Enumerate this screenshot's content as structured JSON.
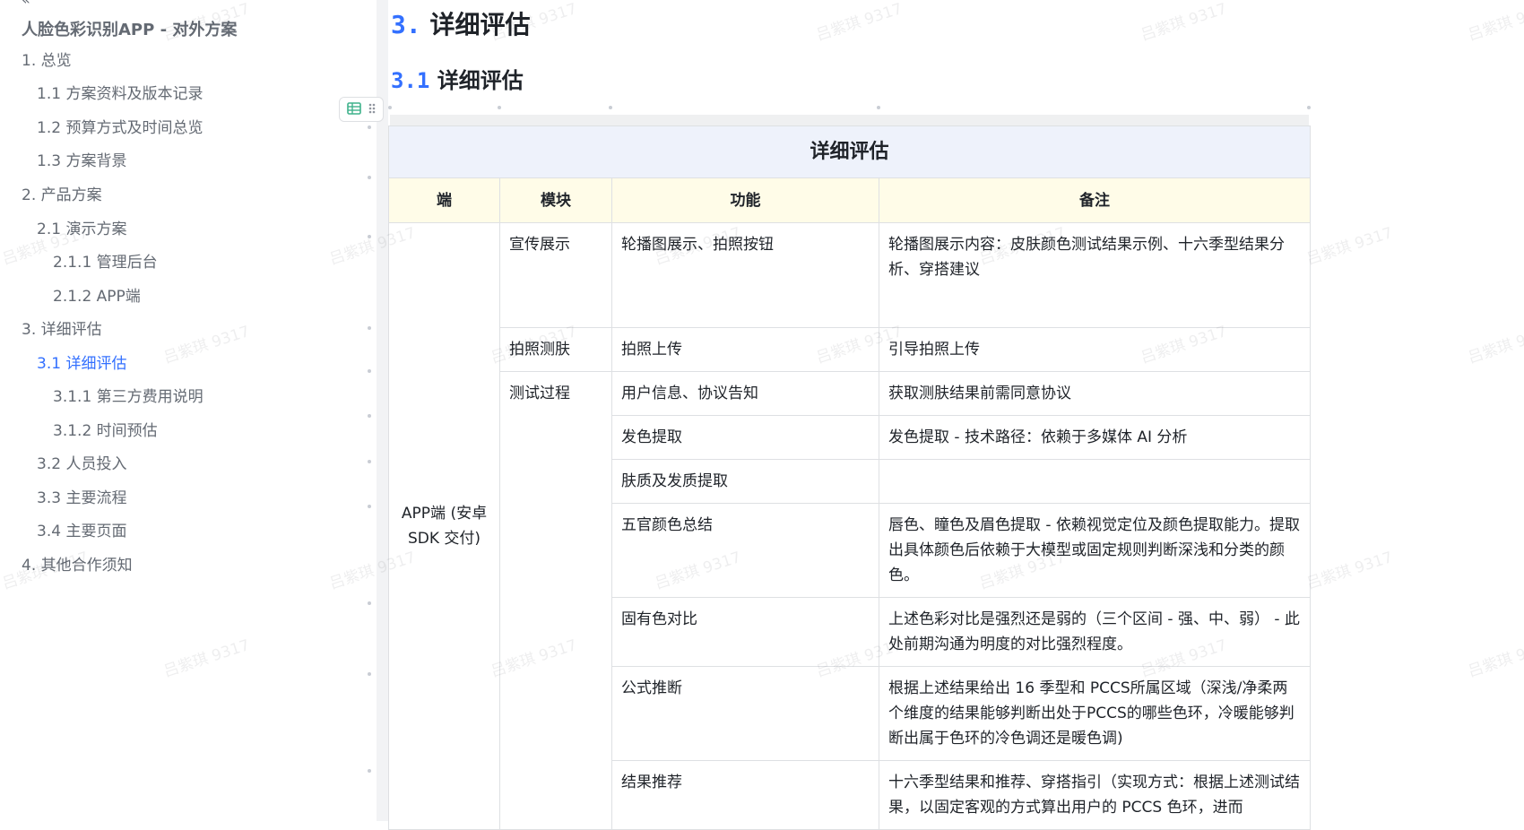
{
  "doc": {
    "collapse_glyph": "«",
    "title": "人脸色彩识别APP - 对外方案"
  },
  "toc": [
    {
      "label": "1. 总览",
      "level": 1
    },
    {
      "label": "1.1 方案资料及版本记录",
      "level": 2
    },
    {
      "label": "1.2 预算方式及时间总览",
      "level": 2
    },
    {
      "label": "1.3 方案背景",
      "level": 2
    },
    {
      "label": "2. 产品方案",
      "level": 1
    },
    {
      "label": "2.1 演示方案",
      "level": 2
    },
    {
      "label": "2.1.1 管理后台",
      "level": 3
    },
    {
      "label": "2.1.2 APP端",
      "level": 3
    },
    {
      "label": "3. 详细评估",
      "level": 1
    },
    {
      "label": "3.1 详细评估",
      "level": 2,
      "active": true
    },
    {
      "label": "3.1.1 第三方费用说明",
      "level": 3
    },
    {
      "label": "3.1.2 时间预估",
      "level": 3
    },
    {
      "label": "3.2 人员投入",
      "level": 2
    },
    {
      "label": "3.3 主要流程",
      "level": 2
    },
    {
      "label": "3.4 主要页面",
      "level": 2
    },
    {
      "label": "4. 其他合作须知",
      "level": 1
    }
  ],
  "heading1": {
    "num": "3.",
    "text": "详细评估"
  },
  "heading2": {
    "num": "3.1",
    "text": "详细评估"
  },
  "table": {
    "title": "详细评估",
    "headers": [
      "端",
      "模块",
      "功能",
      "备注"
    ],
    "endpoint": "APP端 (安卓 SDK 交付)",
    "module_promo": "宣传展示",
    "module_photo": "拍照测肤",
    "module_test": "测试过程",
    "rows": [
      {
        "feature": "轮播图展示、拍照按钮",
        "note": "轮播图展示内容：皮肤颜色测试结果示例、十六季型结果分析、穿搭建议"
      },
      {
        "feature": "拍照上传",
        "note": "引导拍照上传"
      },
      {
        "feature": "用户信息、协议告知",
        "note": "获取测肤结果前需同意协议"
      },
      {
        "feature": "发色提取",
        "note": "发色提取 - 技术路径：依赖于多媒体 AI 分析"
      },
      {
        "feature": "肤质及发质提取",
        "note": ""
      },
      {
        "feature": "五官颜色总结",
        "note": "唇色、瞳色及眉色提取 - 依赖视觉定位及颜色提取能力。提取出具体颜色后依赖于大模型或固定规则判断深浅和分类的颜色。"
      },
      {
        "feature": "固有色对比",
        "note": "上述色彩对比是强烈还是弱的（三个区间 - 强、中、弱） - 此处前期沟通为明度的对比强烈程度。"
      },
      {
        "feature": "公式推断",
        "note": "根据上述结果给出 16 季型和 PCCS所属区域（深浅/净柔两个维度的结果能够判断出处于PCCS的哪些色环，冷暖能够判断出属于色环的冷色调还是暖色调)"
      },
      {
        "feature": "结果推荐",
        "note": "十六季型结果和推荐、穿搭指引（实现方式：根据上述测试结果，以固定客观的方式算出用户的 PCCS 色环，进而"
      }
    ]
  },
  "watermark": "吕紫琪 9317",
  "icons": {
    "table_block": "table-icon",
    "drag": "drag-handle-icon"
  }
}
